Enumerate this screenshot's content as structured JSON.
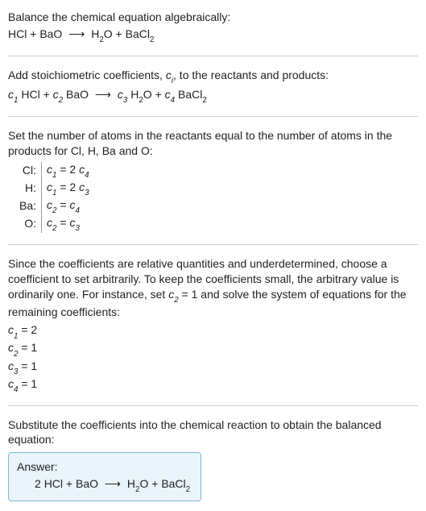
{
  "s1_intro": "Balance the chemical equation algebraically:",
  "eq1_lhs1": "HCl",
  "eq1_plus": " + ",
  "eq1_lhs2": "BaO",
  "arrow": "⟶",
  "eq1_rhs1a": "H",
  "eq1_rhs1s": "2",
  "eq1_rhs1b": "O",
  "eq1_rhs2a": "BaCl",
  "eq1_rhs2s": "2",
  "s2_intro_a": "Add stoichiometric coefficients, ",
  "s2_ci_c": "c",
  "s2_ci_i": "i",
  "s2_intro_b": ", to the reactants and products:",
  "c1c": "c",
  "c1n": "1",
  "c2c": "c",
  "c2n": "2",
  "c3c": "c",
  "c3n": "3",
  "c4c": "c",
  "c4n": "4",
  "sp": " ",
  "s3_intro": "Set the number of atoms in the reactants equal to the number of atoms in the products for Cl, H, Ba and O:",
  "row1_el": "Cl:",
  "row1_t1c": "c",
  "row1_t1n": "1",
  "row1_eq": " = 2 ",
  "row1_t2c": "c",
  "row1_t2n": "4",
  "row2_el": "H:",
  "row2_t1c": "c",
  "row2_t1n": "1",
  "row2_eq": " = 2 ",
  "row2_t2c": "c",
  "row2_t2n": "3",
  "row3_el": "Ba:",
  "row3_t1c": "c",
  "row3_t1n": "2",
  "row3_eq": " = ",
  "row3_t2c": "c",
  "row3_t2n": "4",
  "row4_el": "O:",
  "row4_t1c": "c",
  "row4_t1n": "2",
  "row4_eq": " = ",
  "row4_t2c": "c",
  "row4_t2n": "3",
  "s4_text_a": "Since the coefficients are relative quantities and underdetermined, choose a coefficient to set arbitrarily. To keep the coefficients small, the arbitrary value is ordinarily one. For instance, set ",
  "s4_cc": "c",
  "s4_cn": "2",
  "s4_cv": " = 1",
  "s4_text_b": " and solve the system of equations for the remaining coefficients:",
  "coef1c": "c",
  "coef1n": "1",
  "coef1v": " = 2",
  "coef2c": "c",
  "coef2n": "2",
  "coef2v": " = 1",
  "coef3c": "c",
  "coef3n": "3",
  "coef3v": " = 1",
  "coef4c": "c",
  "coef4n": "4",
  "coef4v": " = 1",
  "s5_text": "Substitute the coefficients into the chemical reaction to obtain the balanced equation:",
  "answer_label": "Answer:",
  "ans_2": "2 ",
  "ans_hcl": "HCl",
  "ans_bao": "BaO",
  "ans_h": "H",
  "ans_h2": "2",
  "ans_o": "O",
  "ans_bacl": "BaCl",
  "ans_bacl2": "2"
}
